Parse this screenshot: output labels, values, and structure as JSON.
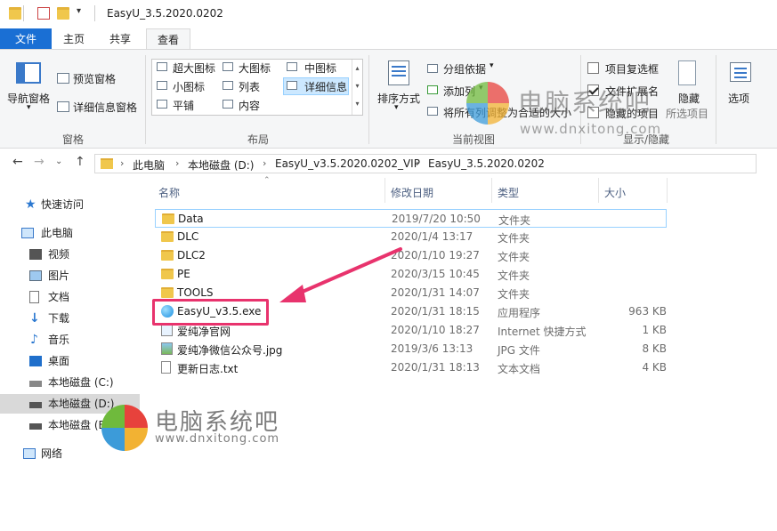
{
  "window": {
    "title": "EasyU_3.5.2020.0202"
  },
  "tabs": [
    {
      "label": "文件"
    },
    {
      "label": "主页"
    },
    {
      "label": "共享"
    },
    {
      "label": "查看"
    }
  ],
  "ribbon": {
    "pane": {
      "nav_pane": "导航窗格",
      "preview_pane": "预览窗格",
      "details_pane": "详细信息窗格",
      "group": "窗格"
    },
    "layout": {
      "items": [
        "超大图标",
        "大图标",
        "中图标",
        "小图标",
        "列表",
        "详细信息",
        "平铺",
        "内容"
      ],
      "group": "布局"
    },
    "current_view": {
      "sort": "排序方式",
      "group_by": "分组依据",
      "add_column": "添加列",
      "fit_columns": "将所有列调整为合适的大小",
      "group": "当前视图"
    },
    "show_hide": {
      "item_checkboxes": "项目复选框",
      "file_extensions": "文件扩展名",
      "hidden_items": "隐藏的项目",
      "hide_selected_line1": "隐藏",
      "hide_selected_line2": "所选项目",
      "group": "显示/隐藏"
    },
    "options": "选项"
  },
  "address": {
    "crumbs": [
      "此电脑",
      "本地磁盘 (D:)",
      "EasyU_v3.5.2020.0202_VIP",
      "EasyU_3.5.2020.0202"
    ]
  },
  "nav": {
    "items": [
      {
        "label": "快速访问",
        "icon": "star-icon"
      },
      {
        "label": "此电脑",
        "icon": "computer-icon"
      },
      {
        "label": "视频",
        "icon": "video-icon"
      },
      {
        "label": "图片",
        "icon": "picture-icon"
      },
      {
        "label": "文档",
        "icon": "document-icon"
      },
      {
        "label": "下载",
        "icon": "download-icon"
      },
      {
        "label": "音乐",
        "icon": "music-icon"
      },
      {
        "label": "桌面",
        "icon": "desktop-icon"
      },
      {
        "label": "本地磁盘 (C:)",
        "icon": "drive-icon"
      },
      {
        "label": "本地磁盘 (D:)",
        "icon": "drive-icon"
      },
      {
        "label": "本地磁盘 (E:)",
        "icon": "drive-icon"
      },
      {
        "label": "网络",
        "icon": "network-icon"
      }
    ]
  },
  "columns": {
    "name": "名称",
    "date": "修改日期",
    "type": "类型",
    "size": "大小"
  },
  "files": [
    {
      "name": "Data",
      "date": "2019/7/20 10:50",
      "type": "文件夹",
      "size": ""
    },
    {
      "name": "DLC",
      "date": "2020/1/4 13:17",
      "type": "文件夹",
      "size": ""
    },
    {
      "name": "DLC2",
      "date": "2020/1/10 19:27",
      "type": "文件夹",
      "size": ""
    },
    {
      "name": "PE",
      "date": "2020/3/15 10:45",
      "type": "文件夹",
      "size": ""
    },
    {
      "name": "TOOLS",
      "date": "2020/1/31 14:07",
      "type": "文件夹",
      "size": ""
    },
    {
      "name": "EasyU_v3.5.exe",
      "date": "2020/1/31 18:15",
      "type": "应用程序",
      "size": "963 KB"
    },
    {
      "name": "爱纯净官网",
      "date": "2020/1/10 18:27",
      "type": "Internet 快捷方式",
      "size": "1 KB"
    },
    {
      "name": "爱纯净微信公众号.jpg",
      "date": "2019/3/6 13:13",
      "type": "JPG 文件",
      "size": "8 KB"
    },
    {
      "name": "更新日志.txt",
      "date": "2020/1/31 18:13",
      "type": "文本文档",
      "size": "4 KB"
    }
  ],
  "watermark": {
    "brand": "电脑系统吧",
    "url": "www.dnxitong.com"
  },
  "colors": {
    "accent": "#1a6fd4",
    "highlight_box": "#e8336d",
    "selection": "#cce8ff"
  }
}
